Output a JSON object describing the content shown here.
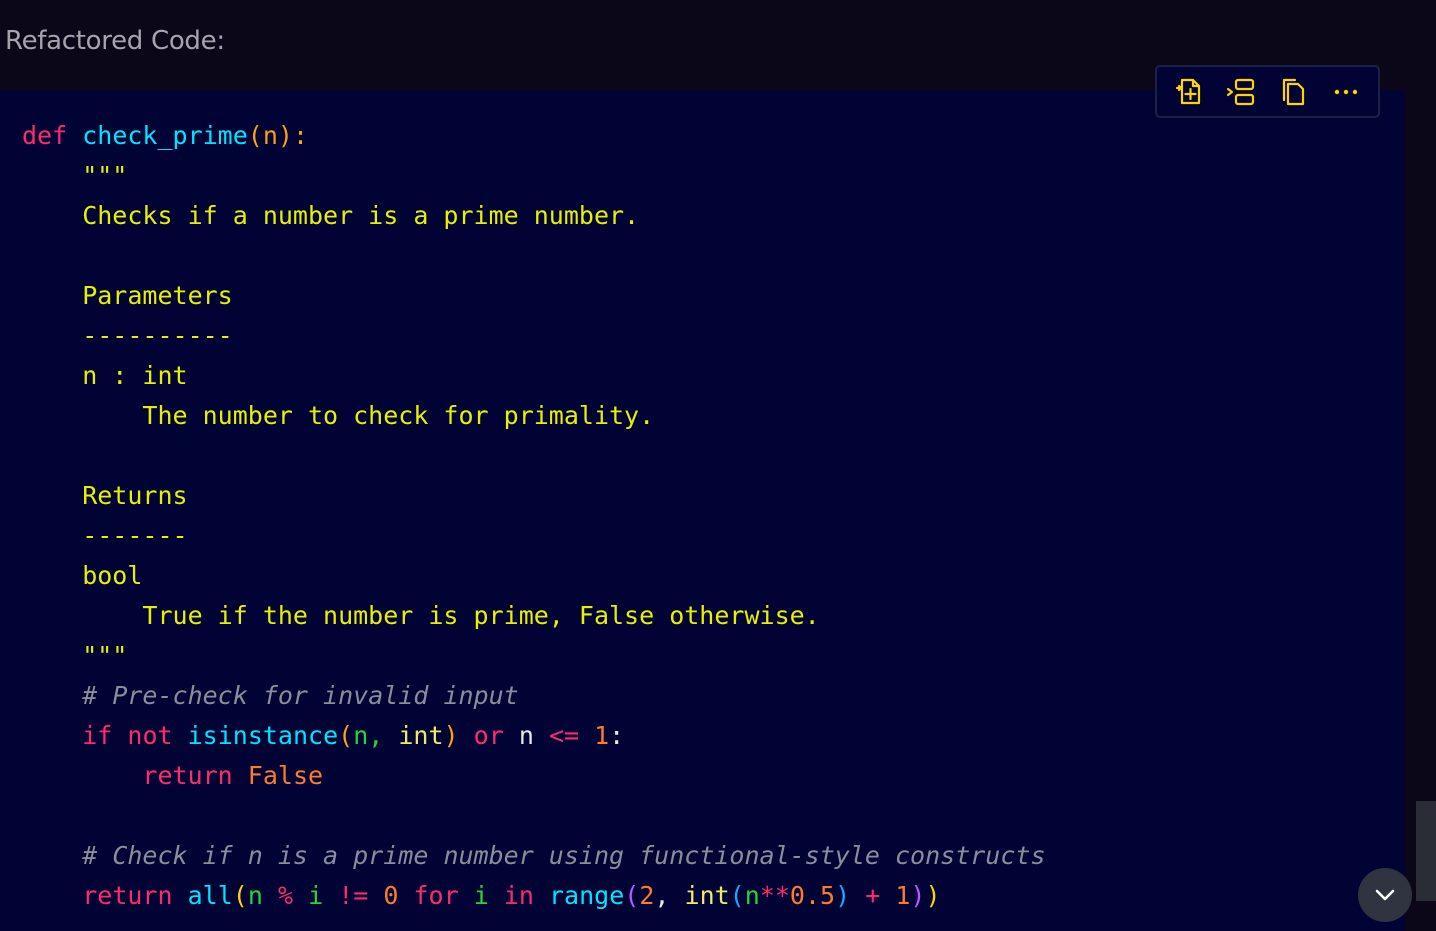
{
  "header": {
    "title": "Refactored Code:"
  },
  "toolbar": {
    "buttons": [
      {
        "name": "insert-into-new-file",
        "icon": "file-add-icon"
      },
      {
        "name": "insert-at-cursor",
        "icon": "insert-icon"
      },
      {
        "name": "copy",
        "icon": "copy-icon"
      },
      {
        "name": "more",
        "icon": "more-icon"
      }
    ],
    "accent_color": "#ffd400"
  },
  "code": {
    "language": "python",
    "tokens": {
      "l1_def": "def",
      "l1_fn": "check_prime",
      "l1_open": "(",
      "l1_param": "n",
      "l1_close": "):",
      "l2_doc": "    \"\"\"",
      "l3_doc": "    Checks if a number is a prime number.",
      "l5_doc": "    Parameters",
      "l6_doc": "    ----------",
      "l7_doc": "    n : int",
      "l8_doc": "        The number to check for primality.",
      "l10_doc": "    Returns",
      "l11_doc": "    -------",
      "l12_doc": "    bool",
      "l13_doc": "        True if the number is prime, False otherwise.",
      "l14_doc": "    \"\"\"",
      "l15_comment": "# Pre-check for invalid input",
      "l16_if": "if",
      "l16_not": "not",
      "l16_isinstance": "isinstance",
      "l16_open": "(",
      "l16_n": "n,",
      "l16_int": "int",
      "l16_close": ")",
      "l16_or": "or",
      "l16_n2": "n",
      "l16_le": "<=",
      "l16_one": "1",
      "l16_colon": ":",
      "l17_return": "return",
      "l17_false": "False",
      "l19_comment": "# Check if n is a prime number using functional-style constructs",
      "l20_return": "return",
      "l20_all": "all",
      "l20_open": "(",
      "l20_n": "n",
      "l20_mod": "%",
      "l20_i": "i",
      "l20_ne": "!=",
      "l20_zero": "0",
      "l20_for": "for",
      "l20_i2": "i",
      "l20_in": "in",
      "l20_range": "range",
      "l20_open2": "(",
      "l20_two": "2",
      "l20_comma": ",",
      "l20_int": "int",
      "l20_open3": "(",
      "l20_npow": "n",
      "l20_pow": "**",
      "l20_half": "0.5",
      "l20_close3": ")",
      "l20_plus": "+",
      "l20_one": "1",
      "l20_close2": ")",
      "l20_close": ")"
    }
  },
  "colors": {
    "background": "#0c0718",
    "code_background": "#000333",
    "keyword": "#ff2a6d",
    "function": "#00e5ff",
    "string": "#e6f000",
    "comment": "#8a8d9a",
    "number": "#ff7a2f"
  }
}
